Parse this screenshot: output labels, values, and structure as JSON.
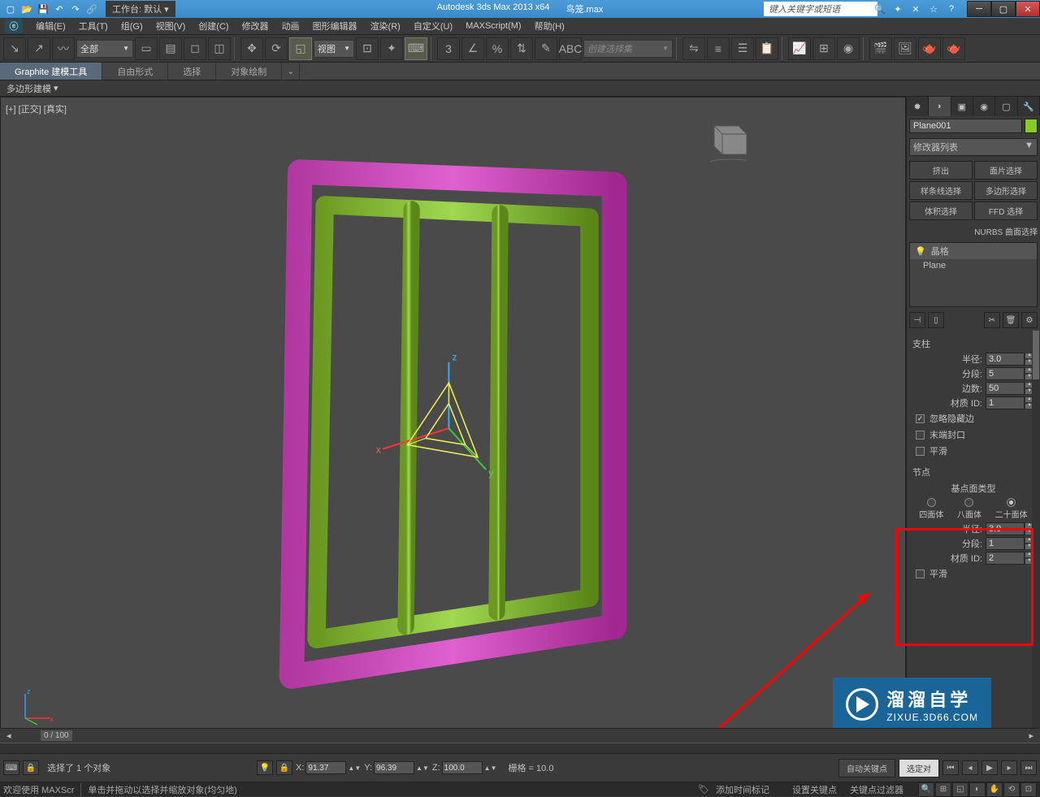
{
  "titlebar": {
    "workspace_label": "工作台: 默认",
    "app_title": "Autodesk 3ds Max  2013 x64",
    "doc_title": "鸟笼.max",
    "search_placeholder": "键入关键字或短语"
  },
  "menus": [
    "编辑(E)",
    "工具(T)",
    "组(G)",
    "视图(V)",
    "创建(C)",
    "修改器",
    "动画",
    "图形编辑器",
    "渲染(R)",
    "自定义(U)",
    "MAXScript(M)",
    "帮助(H)"
  ],
  "toolbar": {
    "filter_all": "全部",
    "ref_dropdown": "视图",
    "named_sel": "创建选择集"
  },
  "ribbon": {
    "tabs": [
      "Graphite 建模工具",
      "自由形式",
      "选择",
      "对象绘制"
    ],
    "sub": "多边形建模"
  },
  "viewport": {
    "label": "[+] [正交] [真实]"
  },
  "cmd": {
    "obj_name": "Plane001",
    "mod_list_label": "修改器列表",
    "mod_buttons": [
      "挤出",
      "面片选择",
      "样条线选择",
      "多边形选择",
      "体积选择",
      "FFD 选择"
    ],
    "nurbs": "NURBS 曲面选择",
    "stack_header": "晶格",
    "stack_item": "Plane"
  },
  "struts": {
    "title": "支柱",
    "radius_label": "半径:",
    "radius": "3.0",
    "segs_label": "分段:",
    "segs": "5",
    "sides_label": "边数:",
    "sides": "50",
    "matid_label": "材质 ID:",
    "matid": "1",
    "ignore_hidden": "忽略隐藏边",
    "end_caps": "末端封口",
    "smooth": "平滑"
  },
  "joints": {
    "title": "节点",
    "base_type": "基点面类型",
    "tetra": "四面体",
    "octa": "八面体",
    "icosa": "二十面体",
    "radius_label": "半径:",
    "radius": "3.0",
    "segs_label": "分段:",
    "segs": "1",
    "matid_label": "材质 ID:",
    "matid": "2",
    "smooth": "平滑"
  },
  "timeline": {
    "slider": "0 / 100"
  },
  "status": {
    "sel": "选择了 1 个对象",
    "x": "91.37",
    "y": "96.39",
    "z": "100.0",
    "grid": "栅格 = 10.0",
    "autokey": "自动关键点",
    "selkey": "选定对",
    "setkey": "设置关键点",
    "keyfilter": "关键点过滤器",
    "welcome": "欢迎使用  MAXScr",
    "hint": "单击并拖动以选择并缩放对象(均匀地)",
    "addmarker": "添加时间标记"
  },
  "watermark": {
    "cn": "溜溜自学",
    "en": "ZIXUE.3D66.COM"
  }
}
